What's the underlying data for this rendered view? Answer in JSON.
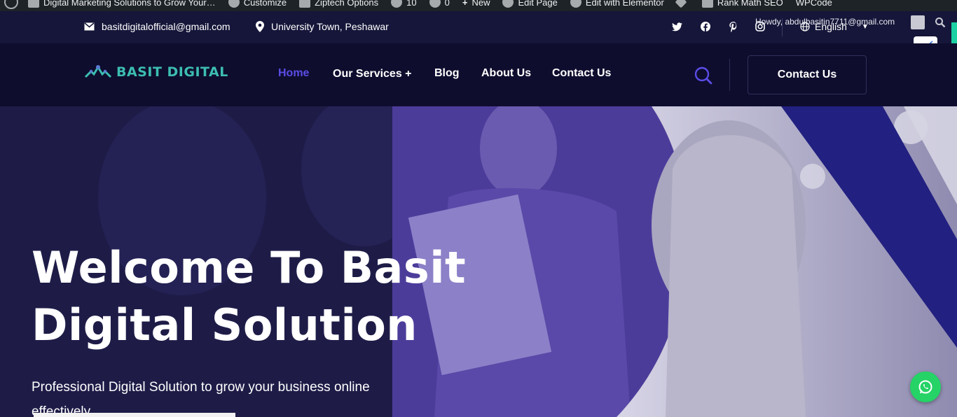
{
  "admin_bar": {
    "items": [
      {
        "label": "Digital Marketing Solutions to Grow Your…"
      },
      {
        "label": "Customize"
      },
      {
        "label": "Ziptech Options"
      },
      {
        "label": "10"
      },
      {
        "label": "0"
      },
      {
        "label": "New"
      },
      {
        "label": "Edit Page"
      },
      {
        "label": "Edit with Elementor"
      },
      {
        "label": ""
      },
      {
        "label": "Rank Math SEO"
      },
      {
        "label": "WPCode"
      }
    ],
    "howdy": "Howdy, abdulbasitin7711@gmail.com"
  },
  "topbar": {
    "email": "basitdigitalofficial@gmail.com",
    "address": "University Town, Peshawar",
    "social": [
      "twitter-icon",
      "facebook-icon",
      "pinterest-icon",
      "instagram-icon"
    ],
    "language": "English"
  },
  "header": {
    "logo_text": "BASIT DIGITAL",
    "nav": [
      {
        "label": "Home",
        "active": true
      },
      {
        "label": "Our Services +"
      },
      {
        "label": "Blog"
      },
      {
        "label": "About Us"
      },
      {
        "label": "Contact Us"
      }
    ],
    "cta_label": "Contact Us"
  },
  "hero": {
    "title_line1": "Welcome To Basit",
    "title_line2": "Digital Solution",
    "subtitle": "Professional Digital Solution to grow your business online effectively."
  },
  "colors": {
    "accent": "#5b4ce6",
    "logo": "#3cbdb0",
    "whatsapp": "#25d366",
    "header_bg": "#0e0d2e",
    "topbar_bg": "#16163a"
  }
}
